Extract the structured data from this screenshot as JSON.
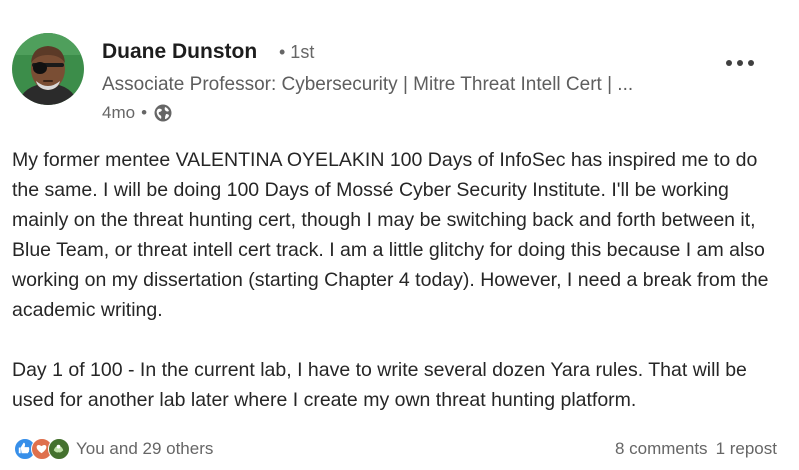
{
  "post": {
    "author": {
      "name": "Duane Dunston",
      "connection": "• 1st",
      "headline": "Associate Professor: Cybersecurity | Mitre Threat Intell Cert | ...",
      "time": "4mo",
      "separator": "•",
      "visibility_icon": "globe-icon",
      "avatar_icon": "profile-photo"
    },
    "more_icon": "more-icon",
    "paragraphs": [
      "My former mentee VALENTINA OYELAKIN 100 Days of InfoSec has inspired me to do the same. I will be doing 100 Days of Mossé Cyber Security Institute. I'll be working mainly on the threat hunting cert, though I may be switching back and forth between it, Blue Team, or threat intell cert track. I am a little glitchy for doing this because I am also working on my dissertation (starting Chapter 4 today). However, I need a break from the academic writing.",
      "Day 1 of 100 - In the current lab, I have to write several dozen Yara rules. That will be used for another lab later where I create my own threat hunting platform."
    ],
    "reactions": {
      "icons": [
        "like-icon",
        "love-icon",
        "support-icon"
      ],
      "colors": {
        "like": "#378fe9",
        "love": "#df704d",
        "support": "#44712e"
      },
      "label": "You and 29 others"
    },
    "engagement": {
      "comments": "8 comments",
      "reposts": "1 repost"
    }
  }
}
